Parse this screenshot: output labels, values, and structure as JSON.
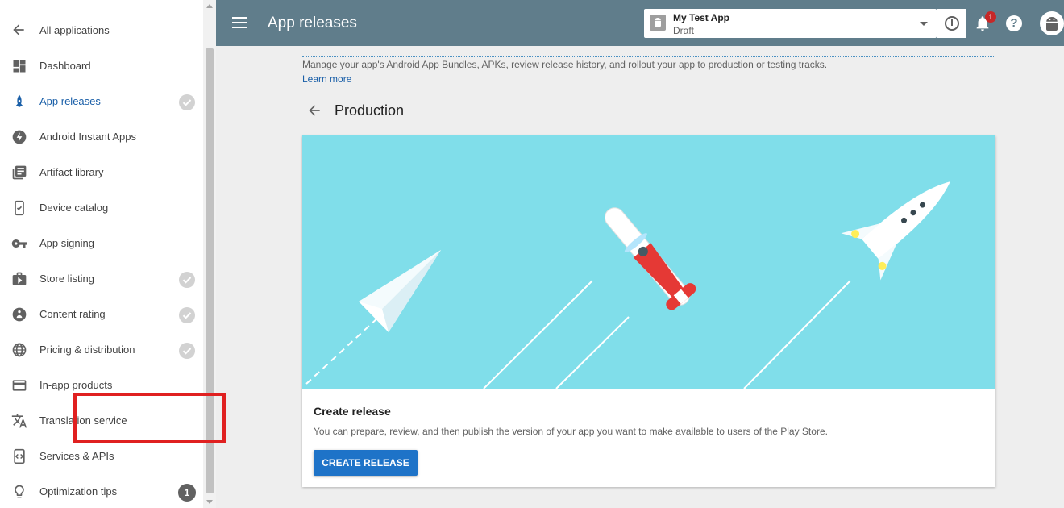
{
  "sidebar": {
    "back_label": "All applications",
    "items": [
      {
        "label": "Dashboard",
        "icon": "dashboard-icon",
        "active": false,
        "status": "none"
      },
      {
        "label": "App releases",
        "icon": "rocket-icon",
        "active": true,
        "status": "check"
      },
      {
        "label": "Android Instant Apps",
        "icon": "flash-icon",
        "active": false,
        "status": "none"
      },
      {
        "label": "Artifact library",
        "icon": "library-icon",
        "active": false,
        "status": "none"
      },
      {
        "label": "Device catalog",
        "icon": "device-check-icon",
        "active": false,
        "status": "none"
      },
      {
        "label": "App signing",
        "icon": "key-icon",
        "active": false,
        "status": "none"
      },
      {
        "label": "Store listing",
        "icon": "shopping-bag-icon",
        "active": false,
        "status": "check"
      },
      {
        "label": "Content rating",
        "icon": "rating-icon",
        "active": false,
        "status": "check"
      },
      {
        "label": "Pricing & distribution",
        "icon": "globe-icon",
        "active": false,
        "status": "check"
      },
      {
        "label": "In-app products",
        "icon": "credit-card-icon",
        "active": false,
        "status": "none"
      },
      {
        "label": "Translation service",
        "icon": "translate-icon",
        "active": false,
        "status": "none"
      },
      {
        "label": "Services & APIs",
        "icon": "code-icon",
        "active": false,
        "status": "none"
      },
      {
        "label": "Optimization tips",
        "icon": "lightbulb-icon",
        "active": false,
        "status": "count",
        "count": "1"
      }
    ]
  },
  "topbar": {
    "title": "App releases",
    "app_name": "My Test App",
    "app_status": "Draft",
    "notification_count": "1",
    "help_symbol": "?"
  },
  "main": {
    "description": "Manage your app's Android App Bundles, APKs, review release history, and rollout your app to production or testing tracks.",
    "learn_more": "Learn more",
    "section_title": "Production",
    "card": {
      "title": "Create release",
      "description": "You can prepare, review, and then publish the version of your app you want to make available to users of the Play Store.",
      "button_label": "CREATE RELEASE"
    }
  },
  "colors": {
    "topbar": "#607d8b",
    "accent": "#1e73c8",
    "illustration_bg": "#80deea",
    "highlight": "#e02020"
  }
}
